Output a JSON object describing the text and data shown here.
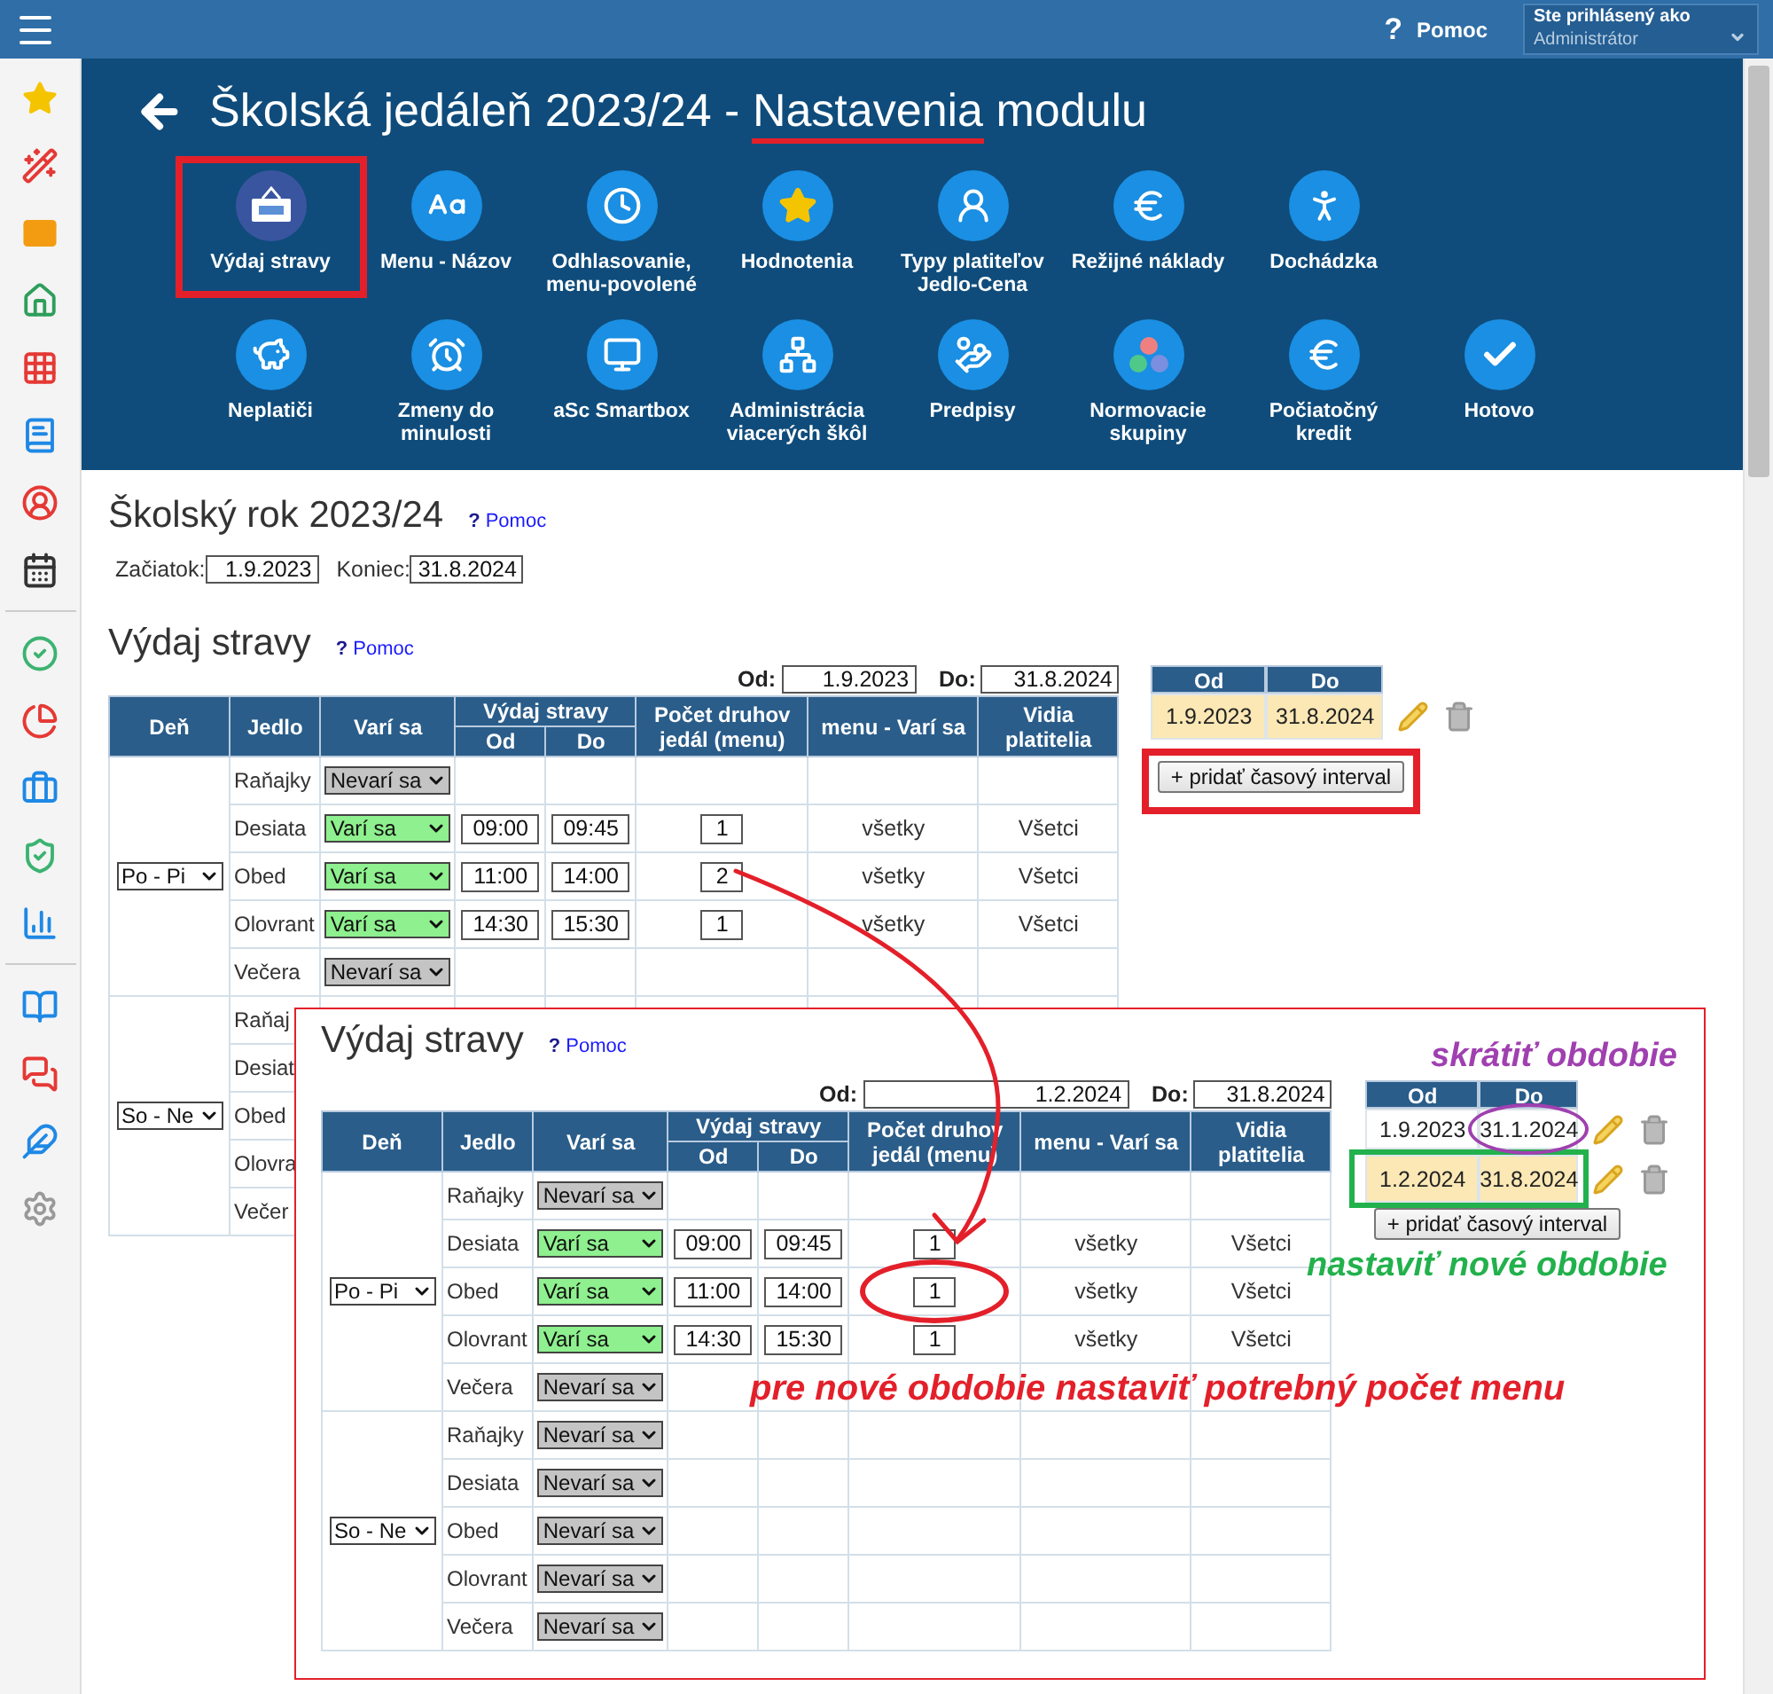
{
  "topbar": {
    "help": {
      "mark": "?",
      "label": "Pomoc"
    },
    "user_label": "Ste prihlásený ako",
    "user_value": "Administrátor"
  },
  "header": {
    "title": [
      {
        "text": "Školská jedáleň 2023/24 - ",
        "underlined": false
      },
      {
        "text": "Nastavenia",
        "underlined": true
      },
      {
        "text": " modulu",
        "underlined": false
      }
    ],
    "module_rows": [
      [
        {
          "label": "Výdaj stravy",
          "outlined": true
        },
        {
          "label": "Menu - Názov",
          "outlined": false
        },
        {
          "label": "Odhlasovanie,\nmenu-povolené",
          "outlined": false
        },
        {
          "label": "Hodnotenia",
          "outlined": false
        },
        {
          "label": "Typy platiteľov\nJedlo-Cena",
          "outlined": false
        },
        {
          "label": "Režijné náklady",
          "outlined": false
        },
        {
          "label": "Dochádzka",
          "outlined": false
        }
      ],
      [
        {
          "label": "Neplatiči",
          "outlined": false
        },
        {
          "label": "Zmeny do\nminulosti",
          "outlined": false
        },
        {
          "label": "aSc Smartbox",
          "outlined": false
        },
        {
          "label": "Administrácia\nviacerých škôl",
          "outlined": false
        },
        {
          "label": "Predpisy",
          "outlined": false
        },
        {
          "label": "Normovacie\nskupiny",
          "outlined": false
        },
        {
          "label": "Počiatočný\nkredit",
          "outlined": false
        },
        {
          "label": "Hotovo",
          "outlined": false
        }
      ]
    ]
  },
  "school_year": {
    "title": "Školský rok 2023/24",
    "help": {
      "mark": "?",
      "label": "Pomoc"
    },
    "start_label": "Začiatok:",
    "start": "1.9.2023",
    "end_label": "Koniec:",
    "end": "31.8.2024"
  },
  "main_panel": {
    "title": "Výdaj stravy",
    "help": {
      "mark": "?",
      "label": "Pomoc"
    },
    "from_label": "Od:",
    "from": "1.9.2023",
    "to_label": "Do:",
    "to": "31.8.2024",
    "columns": [
      "Deň",
      "Jedlo",
      "Varí sa",
      "Výdaj stravy",
      "Počet druhov jedál (menu)",
      "menu - Varí sa",
      "Vidia platitelia"
    ],
    "subcolumns": [
      "Od",
      "Do"
    ],
    "groups": [
      {
        "days": "Po - Pi",
        "rows": [
          {
            "meal": "Raňajky",
            "status": "Nevarí sa",
            "cooking": false
          },
          {
            "meal": "Desiata",
            "status": "Varí sa",
            "cooking": true,
            "from": "09:00",
            "to": "09:45",
            "count": "1",
            "menu": "všetky",
            "visible": "Všetci"
          },
          {
            "meal": "Obed",
            "status": "Varí sa",
            "cooking": true,
            "from": "11:00",
            "to": "14:00",
            "count": "2",
            "menu": "všetky",
            "visible": "Všetci"
          },
          {
            "meal": "Olovrant",
            "status": "Varí sa",
            "cooking": true,
            "from": "14:30",
            "to": "15:30",
            "count": "1",
            "menu": "všetky",
            "visible": "Všetci"
          },
          {
            "meal": "Večera",
            "status": "Nevarí sa",
            "cooking": false
          }
        ]
      },
      {
        "days": "So - Ne",
        "rows": [
          {
            "meal": "Raňaj"
          },
          {
            "meal": "Desiat"
          },
          {
            "meal": "Obed"
          },
          {
            "meal": "Olovra"
          },
          {
            "meal": "Večer"
          }
        ]
      }
    ],
    "interval_columns": [
      "Od",
      "Do"
    ],
    "intervals": [
      {
        "from": "1.9.2023",
        "to": "31.8.2024",
        "selected": true,
        "outlined": false,
        "to_circled": false
      }
    ],
    "add_button": "+ pridať časový interval",
    "add_outlined": true
  },
  "inset_panel": {
    "title": "Výdaj stravy",
    "help": {
      "mark": "?",
      "label": "Pomoc"
    },
    "from_label": "Od:",
    "from": "1.2.2024",
    "to_label": "Do:",
    "to": "31.8.2024",
    "columns": [
      "Deň",
      "Jedlo",
      "Varí sa",
      "Výdaj stravy",
      "Počet druhov jedál (menu)",
      "menu - Varí sa",
      "Vidia platitelia"
    ],
    "subcolumns": [
      "Od",
      "Do"
    ],
    "groups": [
      {
        "days": "Po - Pi",
        "rows": [
          {
            "meal": "Raňajky",
            "status": "Nevarí sa",
            "cooking": false
          },
          {
            "meal": "Desiata",
            "status": "Varí sa",
            "cooking": true,
            "from": "09:00",
            "to": "09:45",
            "count": "1",
            "menu": "všetky",
            "visible": "Všetci"
          },
          {
            "meal": "Obed",
            "status": "Varí sa",
            "cooking": true,
            "from": "11:00",
            "to": "14:00",
            "count": "1",
            "count_circled": true,
            "menu": "všetky",
            "visible": "Všetci"
          },
          {
            "meal": "Olovrant",
            "status": "Varí sa",
            "cooking": true,
            "from": "14:30",
            "to": "15:30",
            "count": "1",
            "menu": "všetky",
            "visible": "Všetci"
          },
          {
            "meal": "Večera",
            "status": "Nevarí sa",
            "cooking": false
          }
        ]
      },
      {
        "days": "So - Ne",
        "rows": [
          {
            "meal": "Raňajky",
            "status": "Nevarí sa",
            "cooking": false
          },
          {
            "meal": "Desiata",
            "status": "Nevarí sa",
            "cooking": false
          },
          {
            "meal": "Obed",
            "status": "Nevarí sa",
            "cooking": false
          },
          {
            "meal": "Olovrant",
            "status": "Nevarí sa",
            "cooking": false
          },
          {
            "meal": "Večera",
            "status": "Nevarí sa",
            "cooking": false
          }
        ]
      }
    ],
    "interval_columns": [
      "Od",
      "Do"
    ],
    "intervals": [
      {
        "from": "1.9.2023",
        "to": "31.1.2024",
        "selected": false,
        "outlined": false,
        "to_circled": true
      },
      {
        "from": "1.2.2024",
        "to": "31.8.2024",
        "selected": true,
        "outlined": true,
        "to_circled": false
      }
    ],
    "add_button": "+ pridať časový interval",
    "add_outlined": false,
    "notes": {
      "shorten": "skrátiť obdobie",
      "new_period": "nastaviť nové obdobie",
      "menu_count": "pre nové obdobie nastaviť potrebný počet menu"
    }
  }
}
